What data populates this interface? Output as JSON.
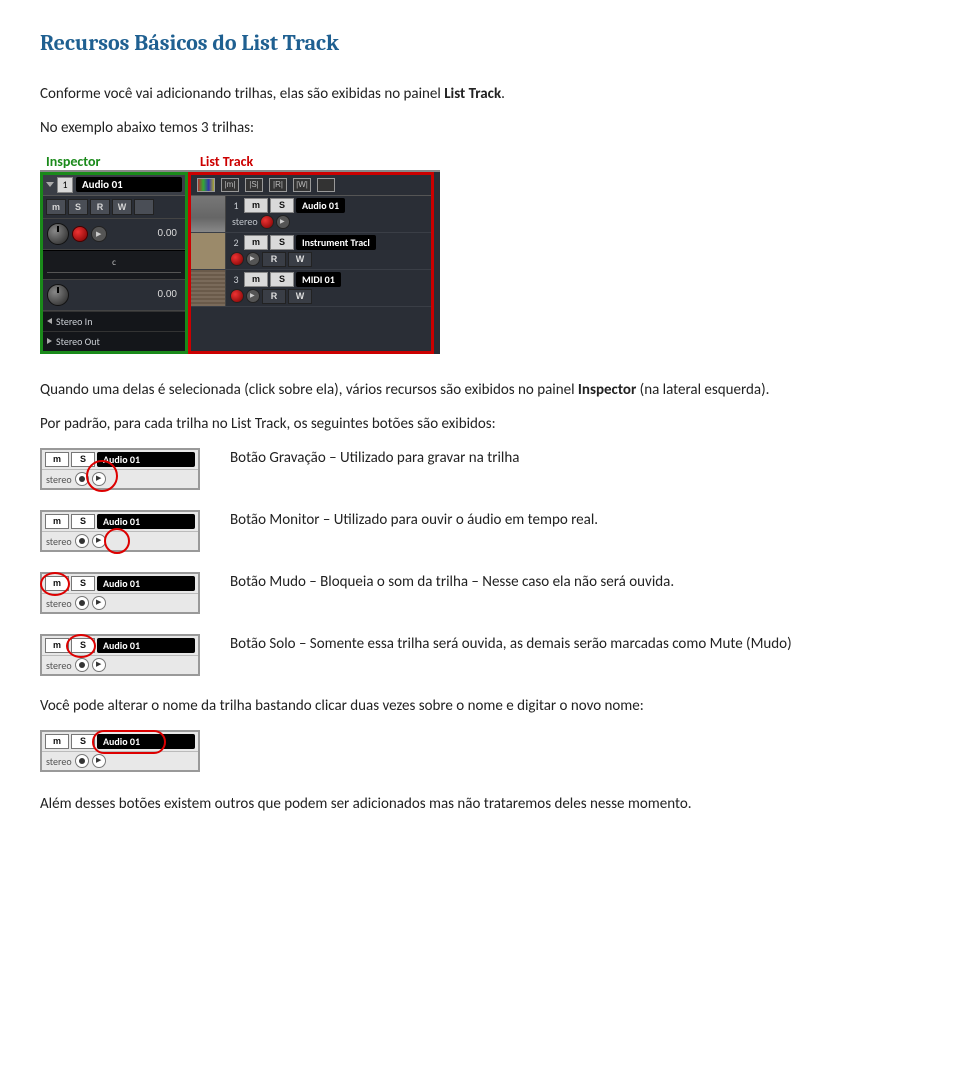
{
  "title": "Recursos Básicos do List Track",
  "intro": {
    "line1_pre": "Conforme você vai adicionando trilhas, elas são exibidas no painel ",
    "line1_bold": "List Track",
    "line1_post": ".",
    "line2": "No exemplo abaixo temos 3 trilhas:"
  },
  "figure_main": {
    "label_inspector": "Inspector",
    "label_listtrack": "List Track",
    "inspector": {
      "track_index": "1",
      "track_name": "Audio 01",
      "btns": [
        "m",
        "S",
        "R",
        "W"
      ],
      "knob_row1_value": "0.00",
      "scale_center": "c",
      "knob_row2_value": "0.00",
      "io_in": "Stereo In",
      "io_out": "Stereo Out"
    },
    "listtrack": {
      "hdr_icons": [
        "",
        "|m|",
        "|S|",
        "|R|",
        "|W|",
        ""
      ],
      "rows": [
        {
          "idx": "1",
          "ms": [
            "m",
            "S"
          ],
          "name": "Audio 01",
          "sub": "stereo",
          "dots": [
            "rec",
            "spk"
          ]
        },
        {
          "idx": "2",
          "ms": [
            "m",
            "S"
          ],
          "name": "Instrument Tracl",
          "sub": "",
          "dots": [
            "rec",
            "spk"
          ],
          "rw": [
            "R",
            "W"
          ]
        },
        {
          "idx": "3",
          "ms": [
            "m",
            "S"
          ],
          "name": "MIDI 01",
          "sub": "",
          "dots": [
            "rec",
            "spk"
          ],
          "rw": [
            "R",
            "W"
          ]
        }
      ]
    }
  },
  "para_after_main_pre": "Quando uma delas é selecionada (click sobre ela), vários recursos são exibidos no painel ",
  "para_after_main_bold": "Inspector",
  "para_after_main_post": " (na lateral esquerda).",
  "para_buttons_intro": "Por padrão, para cada trilha no List Track, os seguintes botões são exibidos:",
  "strips": [
    {
      "m": "m",
      "s": "S",
      "name": "Audio 01",
      "stereo": "stereo",
      "caption": "Botão Gravação – Utilizado para gravar na trilha",
      "highlight": "rec"
    },
    {
      "m": "m",
      "s": "S",
      "name": "Audio 01",
      "stereo": "stereo",
      "caption": "Botão Monitor – Utilizado para ouvir o áudio em tempo real.",
      "highlight": "spk"
    },
    {
      "m": "m",
      "s": "S",
      "name": "Audio 01",
      "stereo": "stereo",
      "caption": "Botão Mudo – Bloqueia o som da trilha – Nesse caso ela não será ouvida.",
      "highlight": "mute"
    },
    {
      "m": "m",
      "s": "S",
      "name": "Audio 01",
      "stereo": "stereo",
      "caption": "Botão Solo – Somente essa trilha será ouvida, as demais serão marcadas como Mute (Mudo)",
      "highlight": "solo"
    }
  ],
  "para_rename": "Você pode alterar o nome da trilha bastando clicar duas vezes sobre o nome e digitar o novo nome:",
  "strip_rename": {
    "m": "m",
    "s": "S",
    "name": "Audio 01",
    "stereo": "stereo",
    "highlight": "name"
  },
  "para_outro": "Além desses botões existem outros que podem ser adicionados mas não trataremos deles nesse momento."
}
